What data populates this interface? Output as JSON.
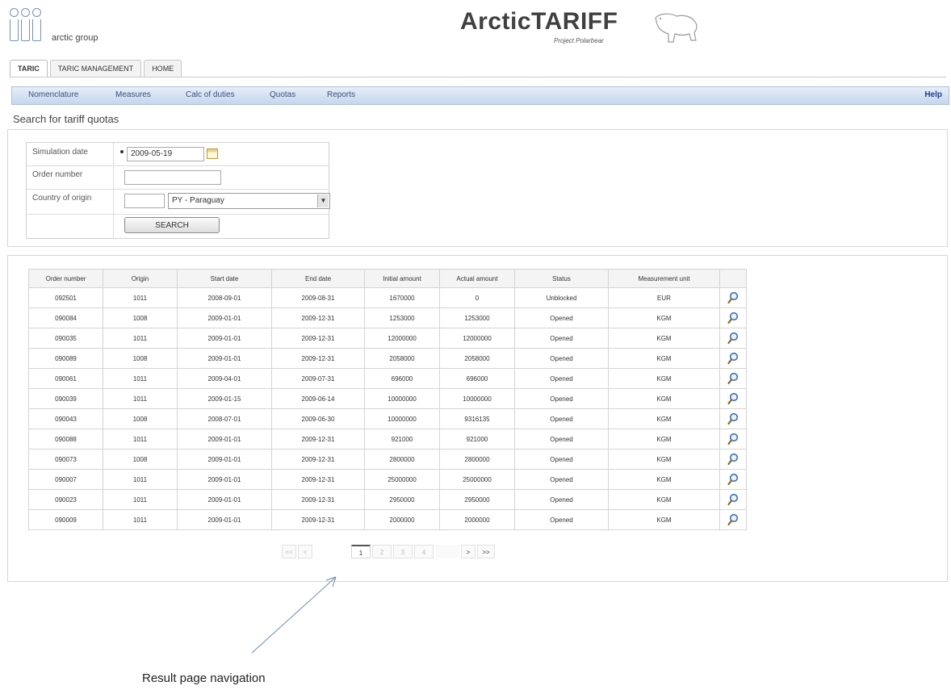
{
  "header": {
    "logo_text": "arctic group",
    "app_title": "ArcticTARIFF",
    "app_subtitle": "Project Polarbear"
  },
  "tabs": [
    {
      "label": "TARIC",
      "active": true
    },
    {
      "label": "TARIC MANAGEMENT",
      "active": false
    },
    {
      "label": "HOME",
      "active": false
    }
  ],
  "menu": {
    "items": [
      "Nomenclature",
      "Measures",
      "Calc of duties",
      "Quotas",
      "Reports"
    ],
    "help": "Help"
  },
  "page_title": "Search for tariff quotas",
  "search_form": {
    "simulation_date_label": "Simulation date",
    "simulation_date_value": "2009-05-19",
    "order_number_label": "Order number",
    "order_number_value": "",
    "country_label": "Country of origin",
    "country_code_value": "",
    "country_selected": "PY - Paraguay",
    "search_button": "SEARCH"
  },
  "results": {
    "headers": [
      "Order number",
      "Origin",
      "Start date",
      "End date",
      "Initial amount",
      "Actual amount",
      "Status",
      "Measurement unit"
    ],
    "rows": [
      [
        "092501",
        "1011",
        "2008-09-01",
        "2009-08-31",
        "1670000",
        "0",
        "Unblocked",
        "EUR"
      ],
      [
        "090084",
        "1008",
        "2009-01-01",
        "2009-12-31",
        "1253000",
        "1253000",
        "Opened",
        "KGM"
      ],
      [
        "090035",
        "1011",
        "2009-01-01",
        "2009-12-31",
        "12000000",
        "12000000",
        "Opened",
        "KGM"
      ],
      [
        "090089",
        "1008",
        "2009-01-01",
        "2009-12-31",
        "2058000",
        "2058000",
        "Opened",
        "KGM"
      ],
      [
        "090061",
        "1011",
        "2009-04-01",
        "2009-07-31",
        "696000",
        "696000",
        "Opened",
        "KGM"
      ],
      [
        "090039",
        "1011",
        "2009-01-15",
        "2009-06-14",
        "10000000",
        "10000000",
        "Opened",
        "KGM"
      ],
      [
        "090043",
        "1008",
        "2008-07-01",
        "2009-06-30",
        "10000000",
        "9316135",
        "Opened",
        "KGM"
      ],
      [
        "090088",
        "1011",
        "2009-01-01",
        "2009-12-31",
        "921000",
        "921000",
        "Opened",
        "KGM"
      ],
      [
        "090073",
        "1008",
        "2009-01-01",
        "2009-12-31",
        "2800000",
        "2800000",
        "Opened",
        "KGM"
      ],
      [
        "090007",
        "1011",
        "2009-01-01",
        "2009-12-31",
        "25000000",
        "25000000",
        "Opened",
        "KGM"
      ],
      [
        "090023",
        "1011",
        "2009-01-01",
        "2009-12-31",
        "2950000",
        "2950000",
        "Opened",
        "KGM"
      ],
      [
        "090009",
        "1011",
        "2009-01-01",
        "2009-12-31",
        "2000000",
        "2000000",
        "Opened",
        "KGM"
      ]
    ],
    "row_action_icon": "magnifier-icon"
  },
  "pager": {
    "first": "<<",
    "prev": "<",
    "pages": [
      "1",
      "2",
      "3",
      "4"
    ],
    "current_page": "1",
    "next": ">",
    "last": ">>"
  },
  "annotation": {
    "text": "Result page navigation"
  },
  "colors": {
    "menubar_top": "#e6eef9",
    "menubar_bottom": "#c6d6ee",
    "menu_text": "#3b4f7c",
    "help_text": "#1f3e92",
    "magnifier_blue": "#3d6fb5"
  }
}
